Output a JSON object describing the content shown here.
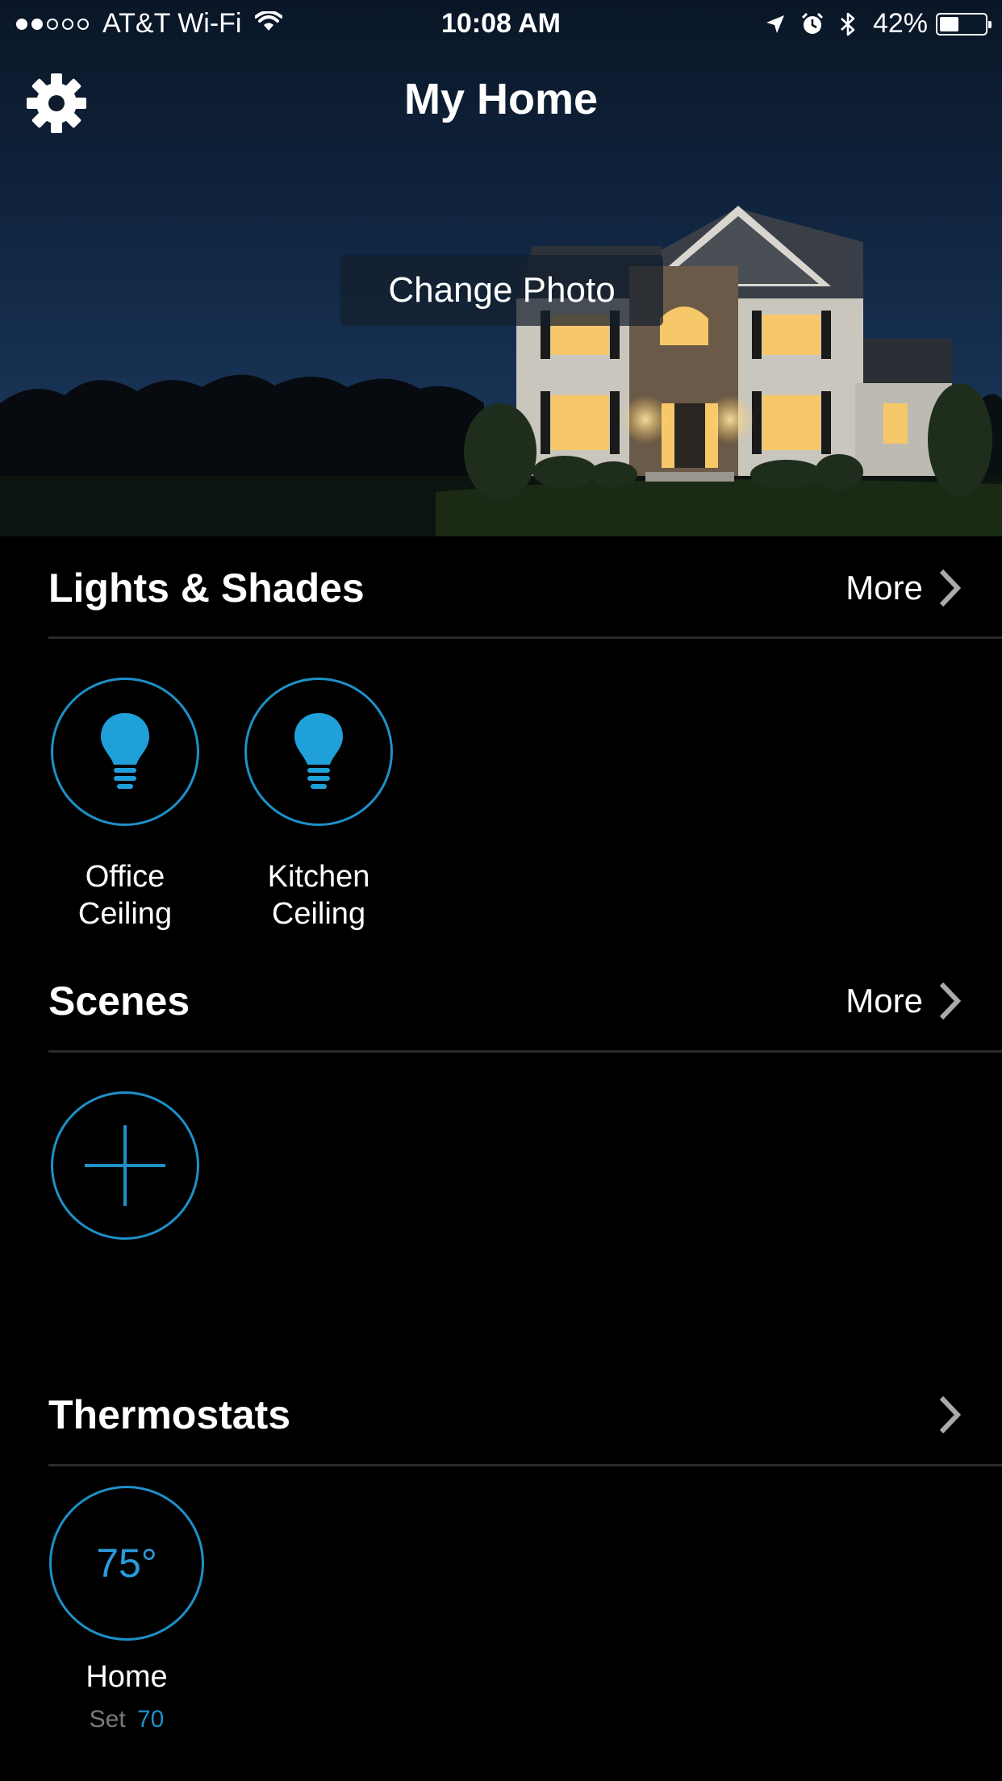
{
  "status_bar": {
    "signal_filled": 2,
    "signal_total": 5,
    "carrier": "AT&T Wi-Fi",
    "time": "10:08 AM",
    "battery_percent": "42%",
    "battery_level": 0.42
  },
  "header": {
    "title": "My Home",
    "change_photo_label": "Change Photo"
  },
  "lights_section": {
    "title": "Lights & Shades",
    "more_label": "More",
    "items": [
      {
        "label_line1": "Office",
        "label_line2": "Ceiling",
        "icon": "light-bulb-icon"
      },
      {
        "label_line1": "Kitchen",
        "label_line2": "Ceiling",
        "icon": "light-bulb-icon"
      }
    ]
  },
  "scenes_section": {
    "title": "Scenes",
    "more_label": "More",
    "add_icon": "plus-icon"
  },
  "thermostats_section": {
    "title": "Thermostats",
    "items": [
      {
        "temperature": "75°",
        "name": "Home",
        "set_label": "Set",
        "set_value": "70"
      }
    ]
  },
  "colors": {
    "accent": "#1e90c8",
    "background": "#000000",
    "divider": "#2a2a2a",
    "muted_text": "#7a7a7a"
  }
}
